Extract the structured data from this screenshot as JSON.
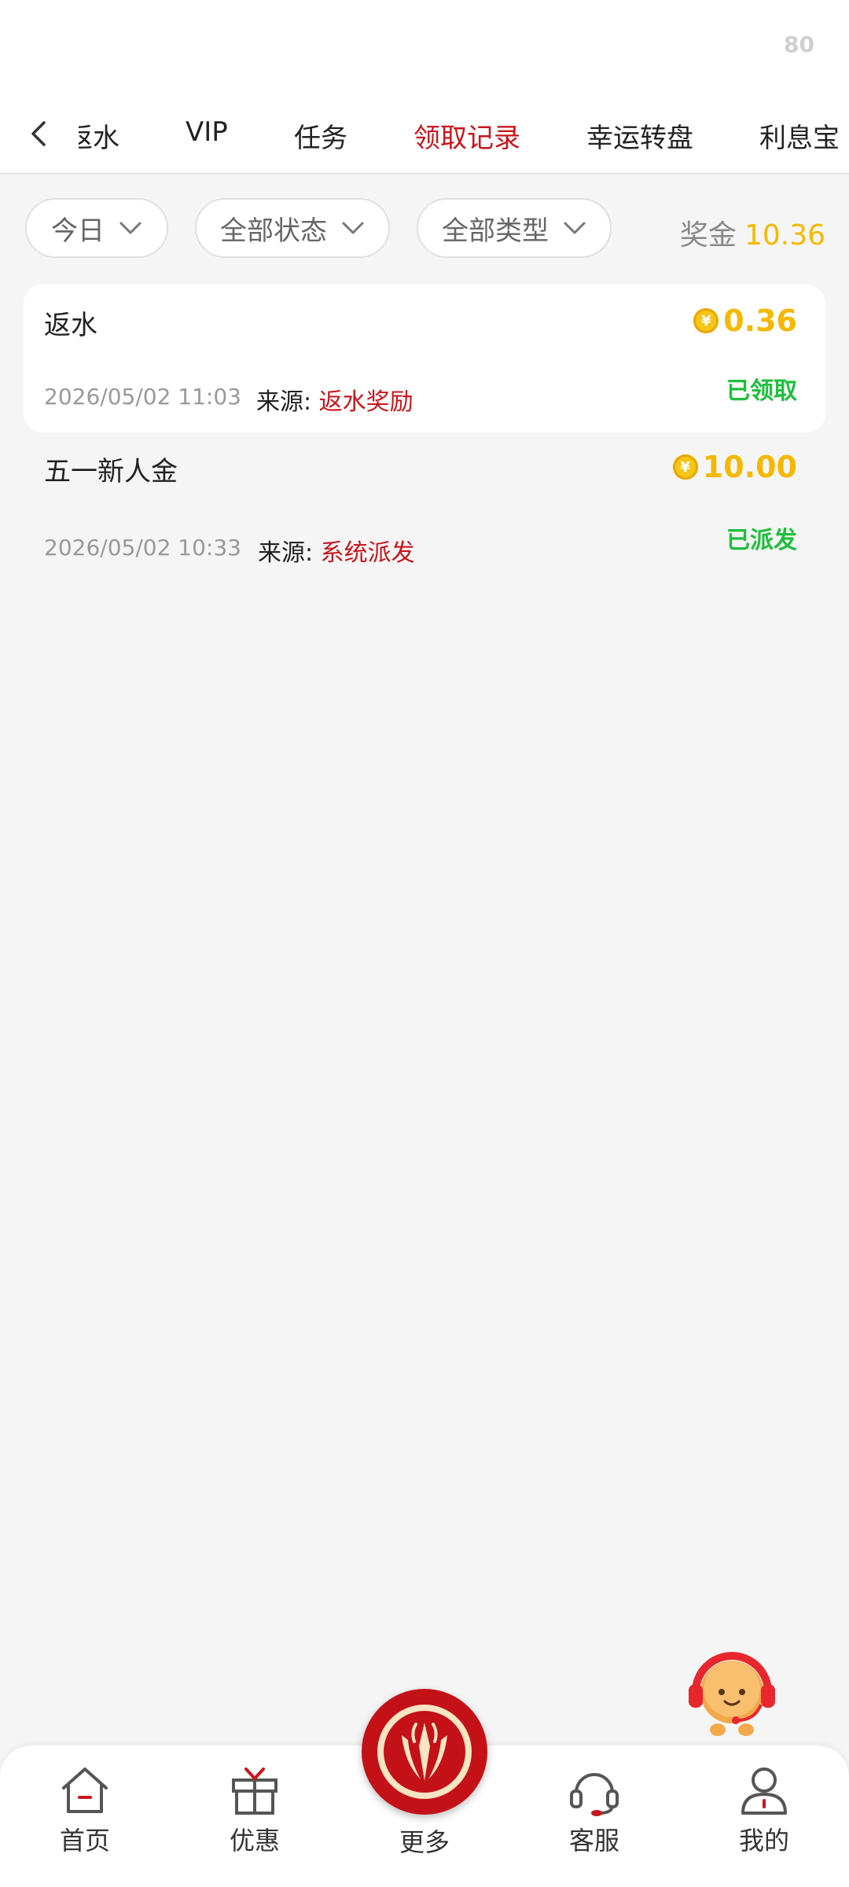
{
  "status_bar": {
    "indicator": "80"
  },
  "tabs": [
    {
      "label": "返水"
    },
    {
      "label": "VIP"
    },
    {
      "label": "任务"
    },
    {
      "label": "领取记录"
    },
    {
      "label": "幸运转盘"
    },
    {
      "label": "利息宝"
    }
  ],
  "active_tab": "领取记录",
  "filters": {
    "date": "今日",
    "status": "全部状态",
    "type": "全部类型",
    "bonus_label": "奖金",
    "bonus_value": "10.36"
  },
  "records": [
    {
      "title": "返水",
      "amount": "0.36",
      "status": "已领取",
      "time": "2026/05/02 11:03",
      "source_label": "来源:",
      "source_value": "返水奖励"
    },
    {
      "title": "五一新人金",
      "amount": "10.00",
      "status": "已派发",
      "time": "2026/05/02 10:33",
      "source_label": "来源:",
      "source_value": "系统派发"
    }
  ],
  "bottom_nav": {
    "home": "首页",
    "promo": "优惠",
    "more": "更多",
    "service": "客服",
    "mine": "我的"
  },
  "colors": {
    "accent_red": "#c8161d",
    "gold": "#f5b800",
    "success_green": "#1fbf3d"
  },
  "icons": {
    "back": "chevron-left-icon",
    "dropdown": "chevron-down-icon",
    "coin": "coin-icon",
    "home": "home-icon",
    "gift": "gift-icon",
    "logo": "brand-logo-icon",
    "headset": "headset-icon",
    "user": "user-icon",
    "mascot": "support-mascot-icon"
  }
}
